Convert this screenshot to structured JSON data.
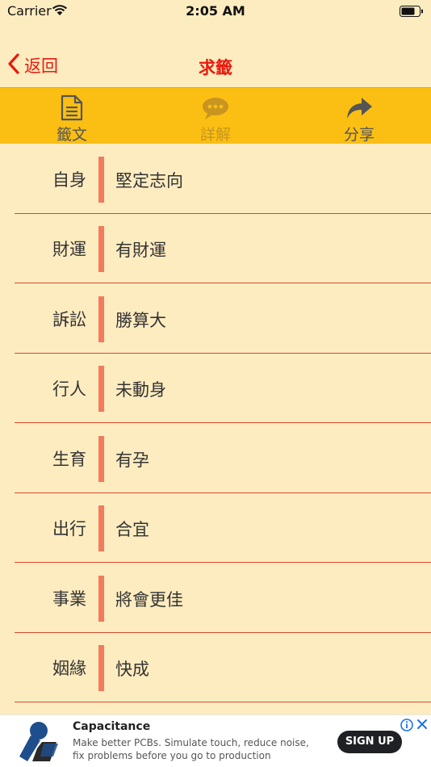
{
  "status_bar": {
    "carrier": "Carrier",
    "time": "2:05 AM"
  },
  "nav": {
    "back_label": "返回",
    "title": "求籤"
  },
  "toolbar": {
    "items": [
      {
        "label": "籤文",
        "icon": "document-icon"
      },
      {
        "label": "詳解",
        "icon": "chat-bubble-icon",
        "disabled": true
      },
      {
        "label": "分享",
        "icon": "share-arrow-icon"
      }
    ]
  },
  "results": [
    {
      "category": "自身",
      "value": "堅定志向"
    },
    {
      "category": "財運",
      "value": "有財運"
    },
    {
      "category": "訴訟",
      "value": "勝算大"
    },
    {
      "category": "行人",
      "value": "未動身"
    },
    {
      "category": "生育",
      "value": "有孕"
    },
    {
      "category": "出行",
      "value": "合宜"
    },
    {
      "category": "事業",
      "value": "將會更佳"
    },
    {
      "category": "姻緣",
      "value": "快成"
    }
  ],
  "ad": {
    "title": "Capacitance",
    "description": "Make better PCBs. Simulate touch, reduce noise, fix problems before you go to production",
    "button_label": "SIGN UP"
  },
  "colors": {
    "background": "#fdecc0",
    "toolbar": "#fbbf13",
    "accent_red": "#e8190f",
    "row_bar": "#f37a5f",
    "divider": "#d9472e"
  }
}
